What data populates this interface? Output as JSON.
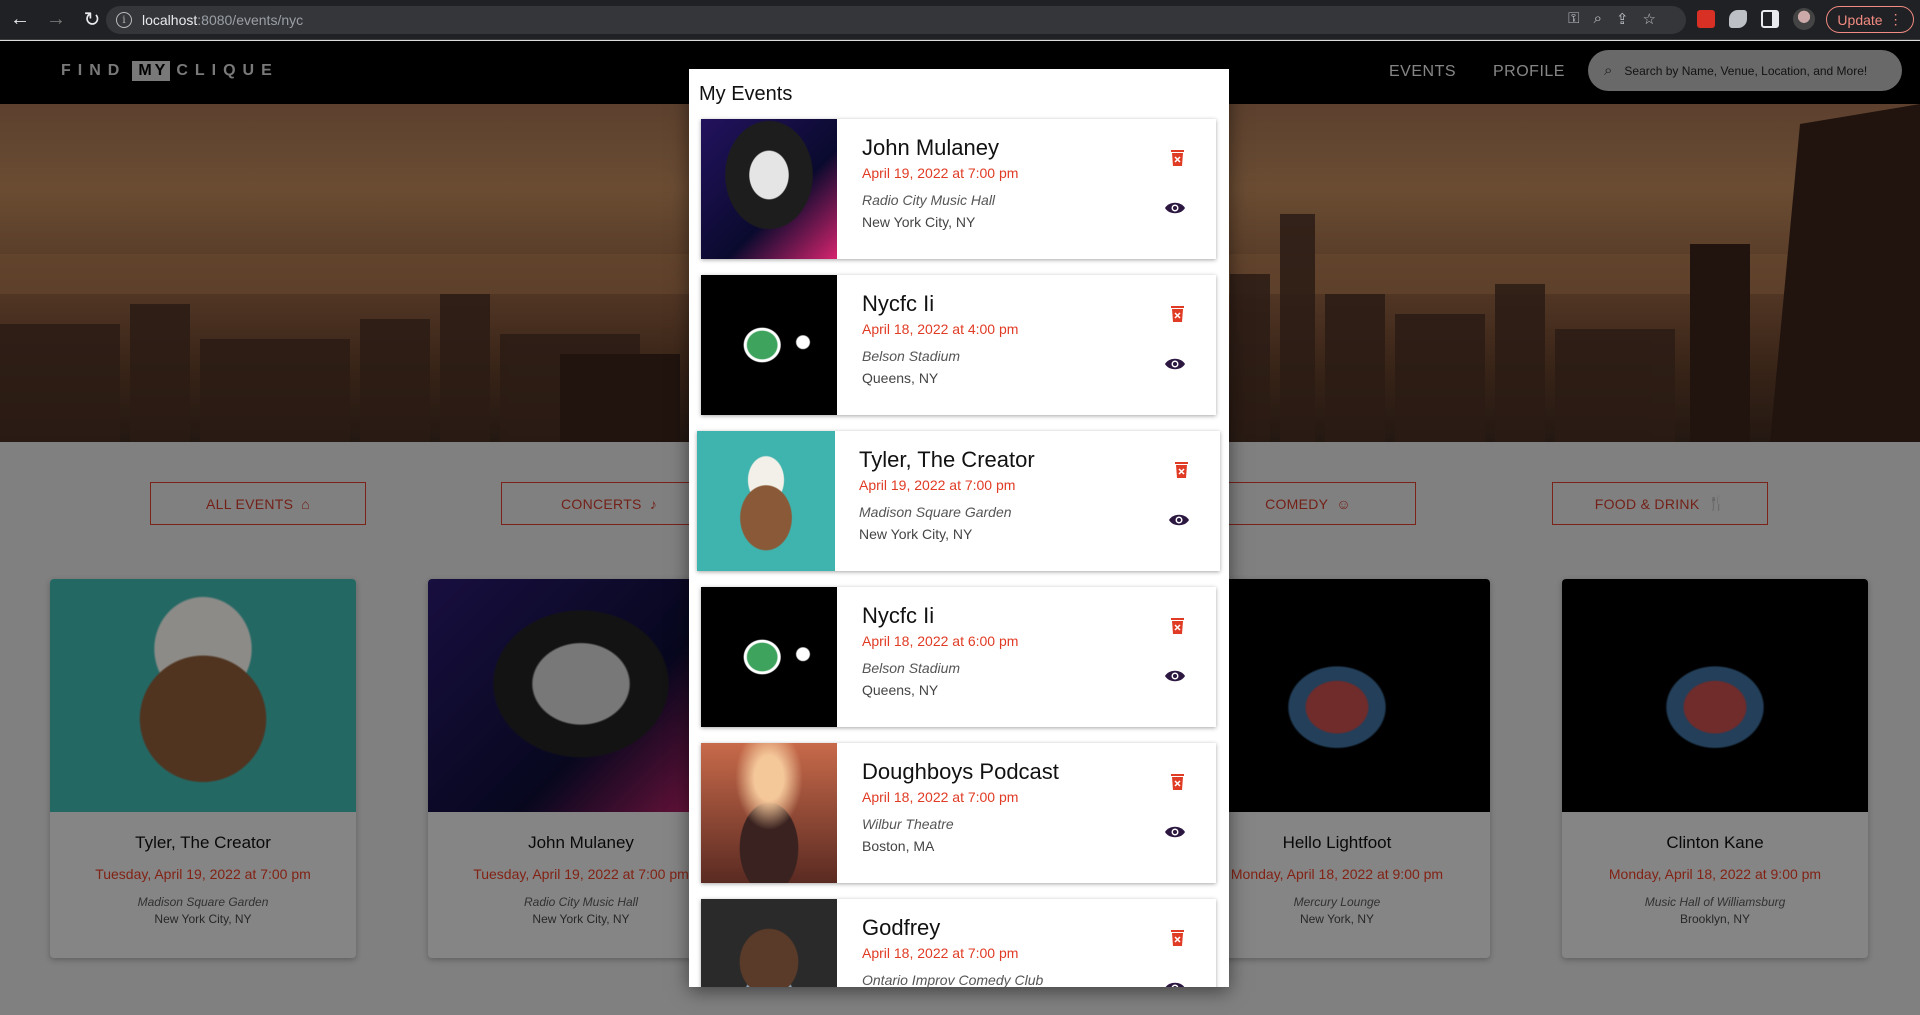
{
  "browser": {
    "host": "localhost",
    "path": ":8080/events/nyc",
    "update_label": "Update"
  },
  "site": {
    "logo_left": "FIND",
    "logo_mid": "MY",
    "logo_right": "CLIQUE",
    "nav": {
      "events": "EVENTS",
      "profile": "PROFILE"
    },
    "search_placeholder": "Search by Name, Venue, Location, and More!"
  },
  "categories": [
    {
      "label": "ALL EVENTS"
    },
    {
      "label": "CONCERTS"
    },
    {
      "label": "COMEDY"
    },
    {
      "label": "FOOD & DRINK"
    }
  ],
  "cards": [
    {
      "title": "Tyler, The Creator",
      "date": "Tuesday, April 19, 2022 at 7:00 pm",
      "venue": "Madison Square Garden",
      "loc": "New York City, NY"
    },
    {
      "title": "John Mulaney",
      "date": "Tuesday, April 19, 2022 at 7:00 pm",
      "venue": "Radio City Music Hall",
      "loc": "New York City, NY"
    },
    {
      "title": "Hello Lightfoot",
      "date": "Monday, April 18, 2022 at 9:00 pm",
      "venue": "Mercury Lounge",
      "loc": "New York, NY"
    },
    {
      "title": "Clinton Kane",
      "date": "Monday, April 18, 2022 at 9:00 pm",
      "venue": "Music Hall of Williamsburg",
      "loc": "Brooklyn, NY"
    }
  ],
  "modal": {
    "title": "My Events",
    "events": [
      {
        "name": "John Mulaney",
        "when": "April 19, 2022 at 7:00 pm",
        "where": "Radio City Music Hall",
        "city": "New York City, NY"
      },
      {
        "name": "Nycfc Ii",
        "when": "April 18, 2022 at 4:00 pm",
        "where": "Belson Stadium",
        "city": "Queens, NY"
      },
      {
        "name": "Tyler, The Creator",
        "when": "April 19, 2022 at 7:00 pm",
        "where": "Madison Square Garden",
        "city": "New York City, NY"
      },
      {
        "name": "Nycfc Ii",
        "when": "April 18, 2022 at 6:00 pm",
        "where": "Belson Stadium",
        "city": "Queens, NY"
      },
      {
        "name": "Doughboys Podcast",
        "when": "April 18, 2022 at 7:00 pm",
        "where": "Wilbur Theatre",
        "city": "Boston, MA"
      },
      {
        "name": "Godfrey",
        "when": "April 18, 2022 at 7:00 pm",
        "where": "Ontario Improv Comedy Club",
        "city": ""
      }
    ]
  },
  "colors": {
    "accent": "#e03b24",
    "nav_bg": "#000000",
    "eye": "#2b1740"
  }
}
